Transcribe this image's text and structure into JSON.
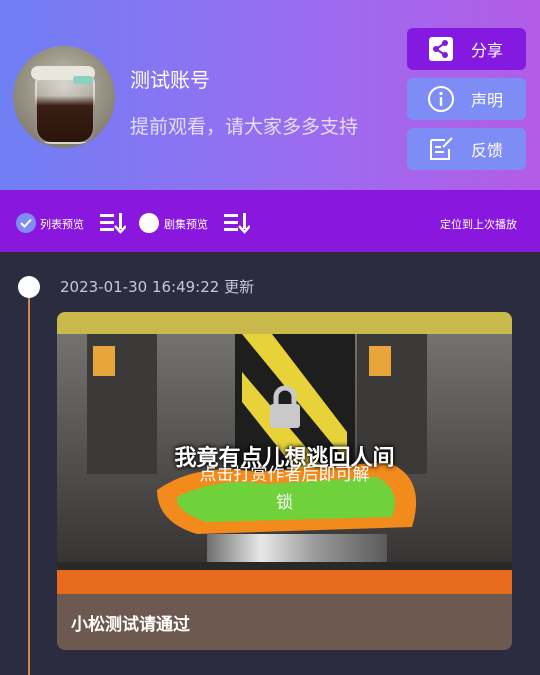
{
  "profile": {
    "username": "测试账号",
    "subtitle": "提前观看，请大家多多支持"
  },
  "actions": {
    "share_label": "分享",
    "declare_label": "声明",
    "feedback_label": "反馈"
  },
  "toolbar": {
    "list_preview_label": "列表预览",
    "episode_preview_label": "剧集预览",
    "locate_label": "定位到上次播放"
  },
  "timeline": {
    "entries": [
      {
        "timestamp": "2023-01-30 16:49:22 更新",
        "overlay_caption": "我竟有点儿想逃回人间",
        "lock_message_line1": "点击打赏作者后即可解",
        "lock_message_line2": "锁",
        "title": "小松测试请通过",
        "locked": true
      }
    ]
  },
  "colors": {
    "header_gradient_start": "#6f7ff4",
    "header_gradient_end": "#b35ce8",
    "toolbar": "#8a17de",
    "share_button": "#8419e0",
    "secondary_button": "#7e8cf6",
    "page_bg": "#2b2c40",
    "timeline_line": "#c98a4a"
  },
  "icons": {
    "share": "share-icon",
    "declare": "info-icon",
    "feedback": "edit-note-icon",
    "sort": "sort-list-icon",
    "lock": "lock-icon"
  }
}
